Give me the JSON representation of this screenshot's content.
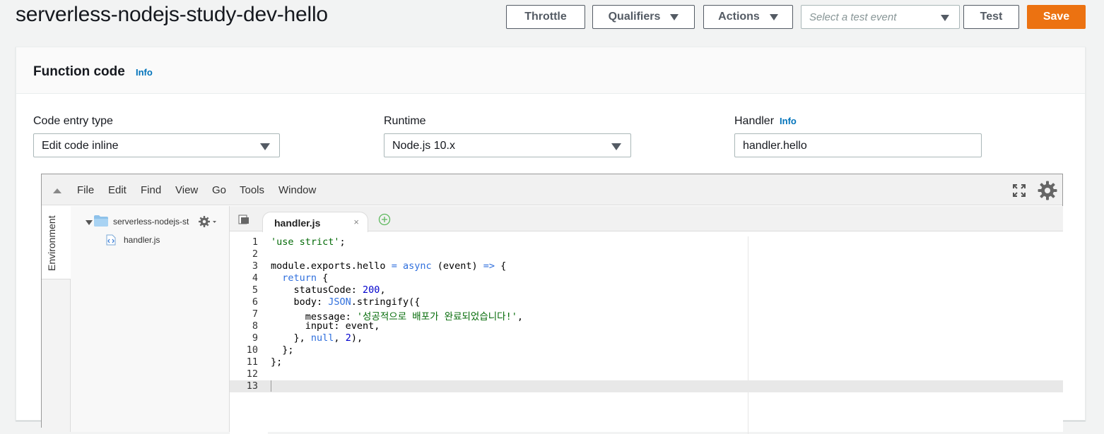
{
  "header": {
    "title": "serverless-nodejs-study-dev-hello",
    "throttle_label": "Throttle",
    "qualifiers_label": "Qualifiers",
    "actions_label": "Actions",
    "test_event_placeholder": "Select a test event",
    "test_label": "Test",
    "save_label": "Save"
  },
  "panel": {
    "title": "Function code",
    "info": "Info",
    "code_entry_label": "Code entry type",
    "code_entry_value": "Edit code inline",
    "runtime_label": "Runtime",
    "runtime_value": "Node.js 10.x",
    "handler_label": "Handler",
    "handler_info": "Info",
    "handler_value": "handler.hello"
  },
  "ide": {
    "menu": [
      "File",
      "Edit",
      "Find",
      "View",
      "Go",
      "Tools",
      "Window"
    ],
    "environment_label": "Environment",
    "tree_root": "serverless-nodejs-st",
    "tree_file": "handler.js",
    "tab_label": "handler.js",
    "tab_close": "×",
    "active_line": 13,
    "line_numbers": [
      "1",
      "2",
      "3",
      "4",
      "5",
      "6",
      "7",
      "8",
      "9",
      "10",
      "11",
      "12",
      "13"
    ],
    "code_lines": [
      "'use strict';",
      "",
      "module.exports.hello = async (event) => {",
      "  return {",
      "    statusCode: 200,",
      "    body: JSON.stringify({",
      "      message: '성공적으로 배포가 완료되었습니다!',",
      "      input: event,",
      "    }, null, 2),",
      "  };",
      "};",
      "",
      ""
    ]
  },
  "colors": {
    "save_button": "#ec7211",
    "info_link": "#0073bb",
    "string": "#036a07",
    "keyword": "#2f6fdd"
  }
}
